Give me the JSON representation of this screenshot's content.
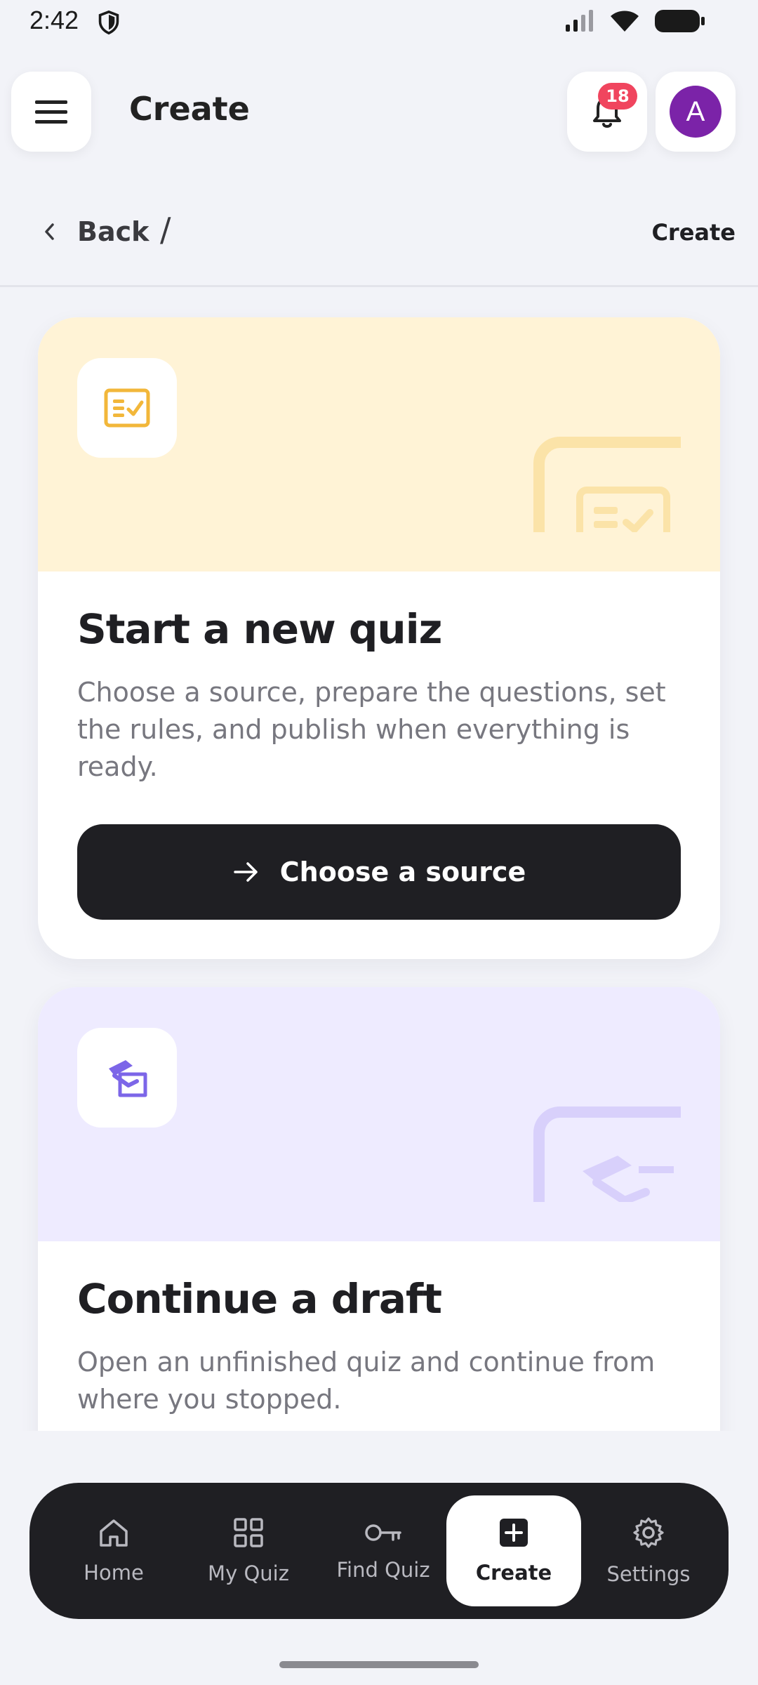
{
  "status_bar": {
    "time": "2:42"
  },
  "header": {
    "title": "Create",
    "notification_count": "18",
    "avatar_initial": "A"
  },
  "breadcrumb": {
    "back_label": "Back",
    "separator": "/",
    "current": "Create"
  },
  "cards": [
    {
      "title": "Start a new quiz",
      "description": "Choose a source, prepare the questions, set the rules, and publish when everything is ready.",
      "button_label": "Choose a source",
      "icon": "checklist-icon",
      "accent": "#f2b73a",
      "hero_color": "#fff3d6"
    },
    {
      "title": "Continue a draft",
      "description": "Open an unfinished quiz and continue from where you stopped.",
      "icon": "draft-icon",
      "accent": "#7c66e8",
      "hero_color": "#eeebff"
    }
  ],
  "bottom_nav": {
    "items": [
      {
        "label": "Home",
        "icon": "home-icon"
      },
      {
        "label": "My Quiz",
        "icon": "grid-icon"
      },
      {
        "label": "Find Quiz",
        "icon": "key-icon"
      },
      {
        "label": "Create",
        "icon": "plus-square-icon",
        "active": true
      },
      {
        "label": "Settings",
        "icon": "gear-icon"
      }
    ]
  }
}
